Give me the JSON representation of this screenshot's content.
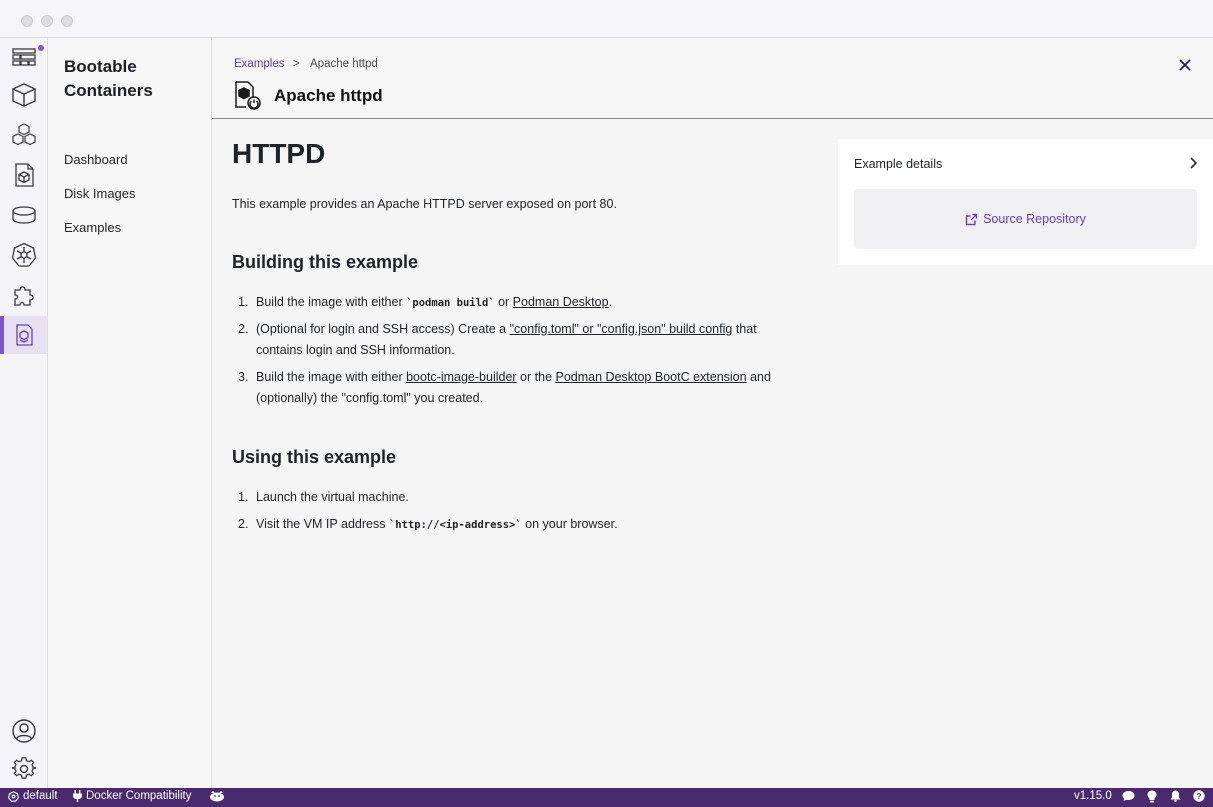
{
  "sidebar": {
    "items": [
      {
        "icon": "dashboard-icon"
      },
      {
        "icon": "containers-icon"
      },
      {
        "icon": "pods-icon"
      },
      {
        "icon": "images-icon"
      },
      {
        "icon": "volumes-icon"
      },
      {
        "icon": "kubernetes-icon"
      },
      {
        "icon": "extensions-icon"
      },
      {
        "icon": "bootable-containers-icon",
        "active": true
      }
    ],
    "bottom": [
      {
        "icon": "account-icon"
      },
      {
        "icon": "settings-icon"
      }
    ]
  },
  "subnav": {
    "title": "Bootable Containers",
    "items": [
      {
        "label": "Dashboard"
      },
      {
        "label": "Disk Images"
      },
      {
        "label": "Examples"
      }
    ]
  },
  "header": {
    "breadcrumb": {
      "link": "Examples",
      "separator": ">",
      "current": "Apache httpd"
    },
    "title": "Apache httpd"
  },
  "content": {
    "heading": "HTTPD",
    "intro": "This example provides an Apache HTTPD server exposed on port 80.",
    "building": {
      "heading": "Building this example",
      "steps": [
        {
          "num": "1.",
          "pre": "Build the image with either ",
          "code": "`podman build`",
          "mid": " or ",
          "link": "Podman Desktop",
          "post": "."
        },
        {
          "num": "2.",
          "pre": "(Optional for login and SSH access) Create a ",
          "link": "\"config.toml\" or \"config.json\" build config",
          "post": " that contains login and SSH information."
        },
        {
          "num": "3.",
          "pre": "Build the image with either ",
          "link": "bootc-image-builder",
          "mid": " or the ",
          "link2": "Podman Desktop BootC extension",
          "post": " and (optionally) the \"config.toml\" you created."
        }
      ]
    },
    "using": {
      "heading": "Using this example",
      "steps": [
        {
          "num": "1.",
          "text": "Launch the virtual machine."
        },
        {
          "num": "2.",
          "pre": "Visit the VM IP address ",
          "code": "`http://<ip-address>`",
          "post": " on your browser."
        }
      ]
    }
  },
  "details": {
    "title": "Example details",
    "repo_label": "Source Repository"
  },
  "statusbar": {
    "context": "default",
    "docker": "Docker Compatibility",
    "version": "v1.15.0"
  },
  "colors": {
    "accent": "#7d56c9",
    "statusbar": "#4a2a6e",
    "link_accent": "#6a40b8"
  }
}
